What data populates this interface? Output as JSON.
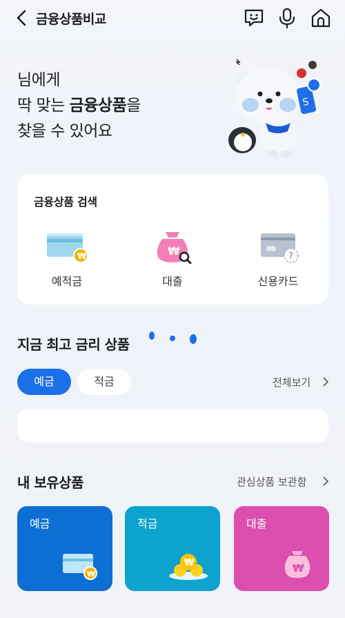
{
  "header": {
    "title": "금융상품비교",
    "icons": [
      "back-icon",
      "chatbot-icon",
      "mic-icon",
      "home-icon"
    ]
  },
  "hero": {
    "line1": "님에게",
    "line2_prefix": "딱 맞는 ",
    "line2_bold": "금융상품",
    "line2_suffix": "을",
    "line3": "찾을 수 있어요"
  },
  "search": {
    "title": "금융상품 검색",
    "items": [
      {
        "label": "예적금",
        "icon": "card-won-icon"
      },
      {
        "label": "대출",
        "icon": "moneybag-search-icon"
      },
      {
        "label": "신용카드",
        "icon": "credit-card-question-icon"
      }
    ]
  },
  "rates": {
    "title": "지금 최고 금리 상품",
    "tabs": [
      {
        "label": "예금",
        "selected": true
      },
      {
        "label": "적금",
        "selected": false
      }
    ],
    "more_label": "전체보기"
  },
  "holdings": {
    "title": "내 보유상품",
    "link_label": "관심상품 보관함",
    "tiles": [
      {
        "label": "예금",
        "color": "#0d6fd3"
      },
      {
        "label": "적금",
        "color": "#0ea3cf"
      },
      {
        "label": "대출",
        "color": "#dc4fae"
      }
    ]
  },
  "colors": {
    "accent": "#1b6fe8",
    "background": "#f1f3f8"
  }
}
